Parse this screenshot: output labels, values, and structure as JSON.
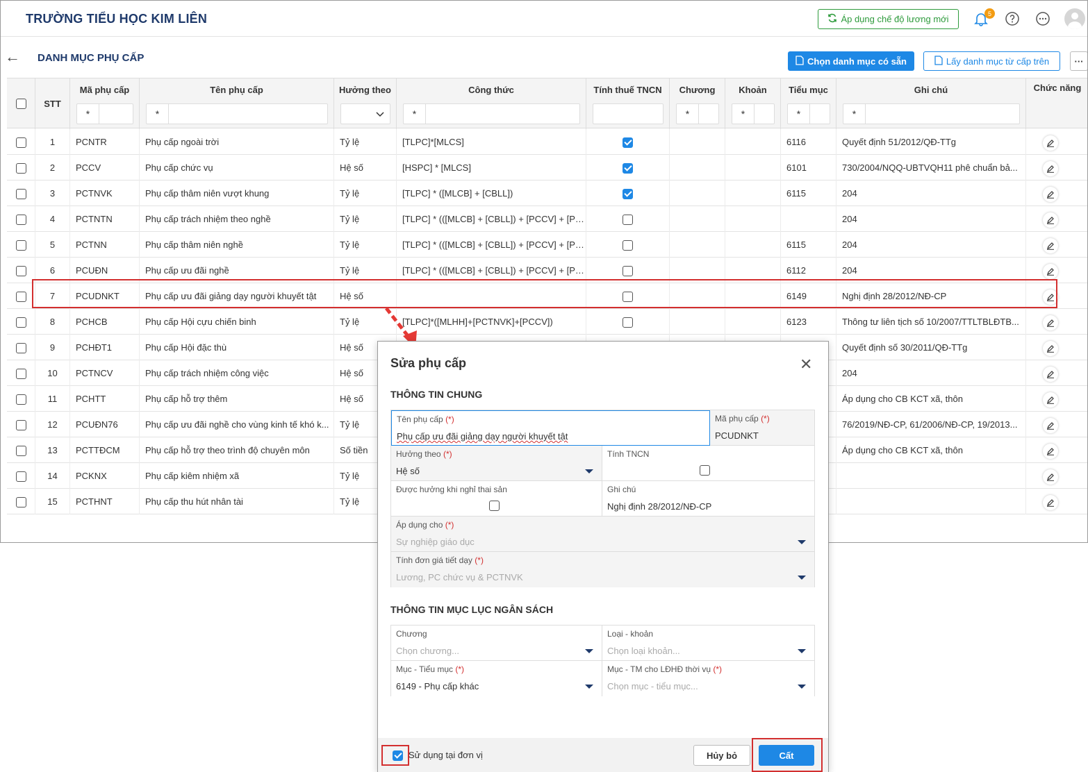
{
  "header": {
    "school_name": "TRƯỜNG TIỂU HỌC KIM LIÊN",
    "apply_button": "Áp dụng chế độ lương mới",
    "notification_count": "5"
  },
  "page": {
    "title": "DANH MỤC PHỤ CẤP",
    "choose_list_button": "Chọn danh mục có sẵn",
    "fetch_list_button": "Lấy danh mục từ cấp trên",
    "more_button": "···"
  },
  "table": {
    "columns": {
      "stt": "STT",
      "code": "Mã phụ cấp",
      "name": "Tên phụ cấp",
      "basis": "Hưởng theo",
      "formula": "Công thức",
      "tax": "Tính thuế TNCN",
      "chapter": "Chương",
      "section": "Khoản",
      "subitem": "Tiểu mục",
      "note": "Ghi chú",
      "actions": "Chức năng"
    },
    "filter_op": "*",
    "rows": [
      {
        "stt": "1",
        "code": "PCNTR",
        "name": "Phụ cấp ngoài trời",
        "basis": "Tỷ lệ",
        "formula": "[TLPC]*[MLCS]",
        "tax": true,
        "subitem": "6116",
        "note": "Quyết định 51/2012/QĐ-TTg"
      },
      {
        "stt": "2",
        "code": "PCCV",
        "name": "Phụ cấp chức vụ",
        "basis": "Hệ số",
        "formula": "[HSPC] * [MLCS]",
        "tax": true,
        "subitem": "6101",
        "note": "730/2004/NQQ-UBTVQH11  phê chuẩn bả..."
      },
      {
        "stt": "3",
        "code": "PCTNVK",
        "name": "Phụ cấp thâm niên vượt khung",
        "basis": "Tỷ lệ",
        "formula": "[TLPC] * ([MLCB] + [CBLL])",
        "tax": true,
        "subitem": "6115",
        "note": "204"
      },
      {
        "stt": "4",
        "code": "PCTNTN",
        "name": "Phụ cấp trách nhiệm theo nghề",
        "basis": "Tỷ lệ",
        "formula": "[TLPC] * (([MLCB] + [CBLL]) + [PCCV] + [PC...",
        "tax": false,
        "subitem": "",
        "note": "204"
      },
      {
        "stt": "5",
        "code": "PCTNN",
        "name": "Phụ cấp thâm niên nghề",
        "basis": "Tỷ lệ",
        "formula": "[TLPC] * (([MLCB] + [CBLL]) + [PCCV] + [PC...",
        "tax": false,
        "subitem": "6115",
        "note": "204"
      },
      {
        "stt": "6",
        "code": "PCUĐN",
        "name": "Phụ cấp ưu đãi nghề",
        "basis": "Tỷ lệ",
        "formula": "[TLPC] * (([MLCB] + [CBLL]) + [PCCV] + [PC...",
        "tax": false,
        "subitem": "6112",
        "note": "204"
      },
      {
        "stt": "7",
        "code": "PCUDNKT",
        "name": "Phụ cấp ưu đãi giảng dạy người khuyết tật",
        "basis": "Hệ số",
        "formula": "",
        "tax": false,
        "subitem": "6149",
        "note": "Nghị định 28/2012/NĐ-CP"
      },
      {
        "stt": "8",
        "code": "PCHCB",
        "name": "Phụ cấp Hội cựu chiến binh",
        "basis": "Tỷ lệ",
        "formula": "[TLPC]*([MLHH]+[PCTNVK]+[PCCV])",
        "tax": false,
        "subitem": "6123",
        "note": "Thông tư liên tịch số 10/2007/TTLTBLĐTB..."
      },
      {
        "stt": "9",
        "code": "PCHĐT1",
        "name": "Phụ cấp Hội đặc thù",
        "basis": "Hệ số",
        "formula": "",
        "tax": null,
        "subitem": "",
        "note": "Quyết định số 30/2011/QĐ-TTg"
      },
      {
        "stt": "10",
        "code": "PCTNCV",
        "name": "Phụ cấp trách nhiệm công việc",
        "basis": "Hệ số",
        "formula": "",
        "tax": null,
        "subitem": "",
        "note": "204"
      },
      {
        "stt": "11",
        "code": "PCHTT",
        "name": "Phụ cấp hỗ trợ thêm",
        "basis": "Hệ số",
        "formula": "",
        "tax": null,
        "subitem": "",
        "note": "Áp dụng cho CB KCT xã, thôn"
      },
      {
        "stt": "12",
        "code": "PCUĐN76",
        "name": "Phụ cấp ưu đãi nghề cho vùng kinh tế khó k...",
        "basis": "Tỷ lệ",
        "formula": "",
        "tax": null,
        "subitem": "",
        "note": "76/2019/NĐ-CP, 61/2006/NĐ-CP, 19/2013..."
      },
      {
        "stt": "13",
        "code": "PCTTĐCM",
        "name": "Phụ cấp hỗ trợ theo trình độ chuyên môn",
        "basis": "Số tiền",
        "formula": "",
        "tax": null,
        "subitem": "",
        "note": "Áp dụng cho CB KCT xã, thôn"
      },
      {
        "stt": "14",
        "code": "PCKNX",
        "name": "Phụ cấp kiêm nhiệm xã",
        "basis": "Tỷ lệ",
        "formula": "",
        "tax": null,
        "subitem": "",
        "note": ""
      },
      {
        "stt": "15",
        "code": "PCTHNT",
        "name": "Phụ cấp thu hút nhân tài",
        "basis": "Tỷ lệ",
        "formula": "",
        "tax": null,
        "subitem": "",
        "note": ""
      }
    ]
  },
  "modal": {
    "title": "Sửa phụ cấp",
    "section_general": "THÔNG TIN CHUNG",
    "section_budget": "THÔNG TIN MỤC LỤC NGÂN SÁCH",
    "required_mark": "(*)",
    "fields": {
      "name_label": "Tên phụ cấp",
      "name_value": "Phụ cấp ưu đãi giảng dạy người khuyết tật",
      "code_label": "Mã phụ cấp",
      "code_value": "PCUDNKT",
      "basis_label": "Hưởng theo",
      "basis_value": "Hệ số",
      "tax_label": "Tính TNCN",
      "maternity_label": "Được hưởng khi nghỉ thai sản",
      "note_label": "Ghi chú",
      "note_value": "Nghị định 28/2012/NĐ-CP",
      "apply_label": "Áp dụng cho",
      "apply_value": "Sự nghiệp giáo dục",
      "unit_price_label": "Tính đơn giá tiết dạy",
      "unit_price_value": "Lương, PC chức vụ & PCTNVK",
      "chapter_label": "Chương",
      "chapter_placeholder": "Chọn chương...",
      "type_label": "Loại - khoản",
      "type_placeholder": "Chọn loại khoản...",
      "item_label": "Mục - Tiểu mục",
      "item_value": "6149 - Phụ cấp khác",
      "item_ldhd_label": "Mục - TM cho LĐHĐ thời vụ",
      "item_ldhd_placeholder": "Chọn mục - tiểu mục..."
    },
    "use_at_unit_label": "Sử dụng tại đơn vị",
    "cancel_button": "Hủy bỏ",
    "save_button": "Cất"
  },
  "colors": {
    "primary": "#1e88e5",
    "highlight": "#d32f2f",
    "success": "#2e9b3c",
    "title": "#1f3a6b"
  }
}
